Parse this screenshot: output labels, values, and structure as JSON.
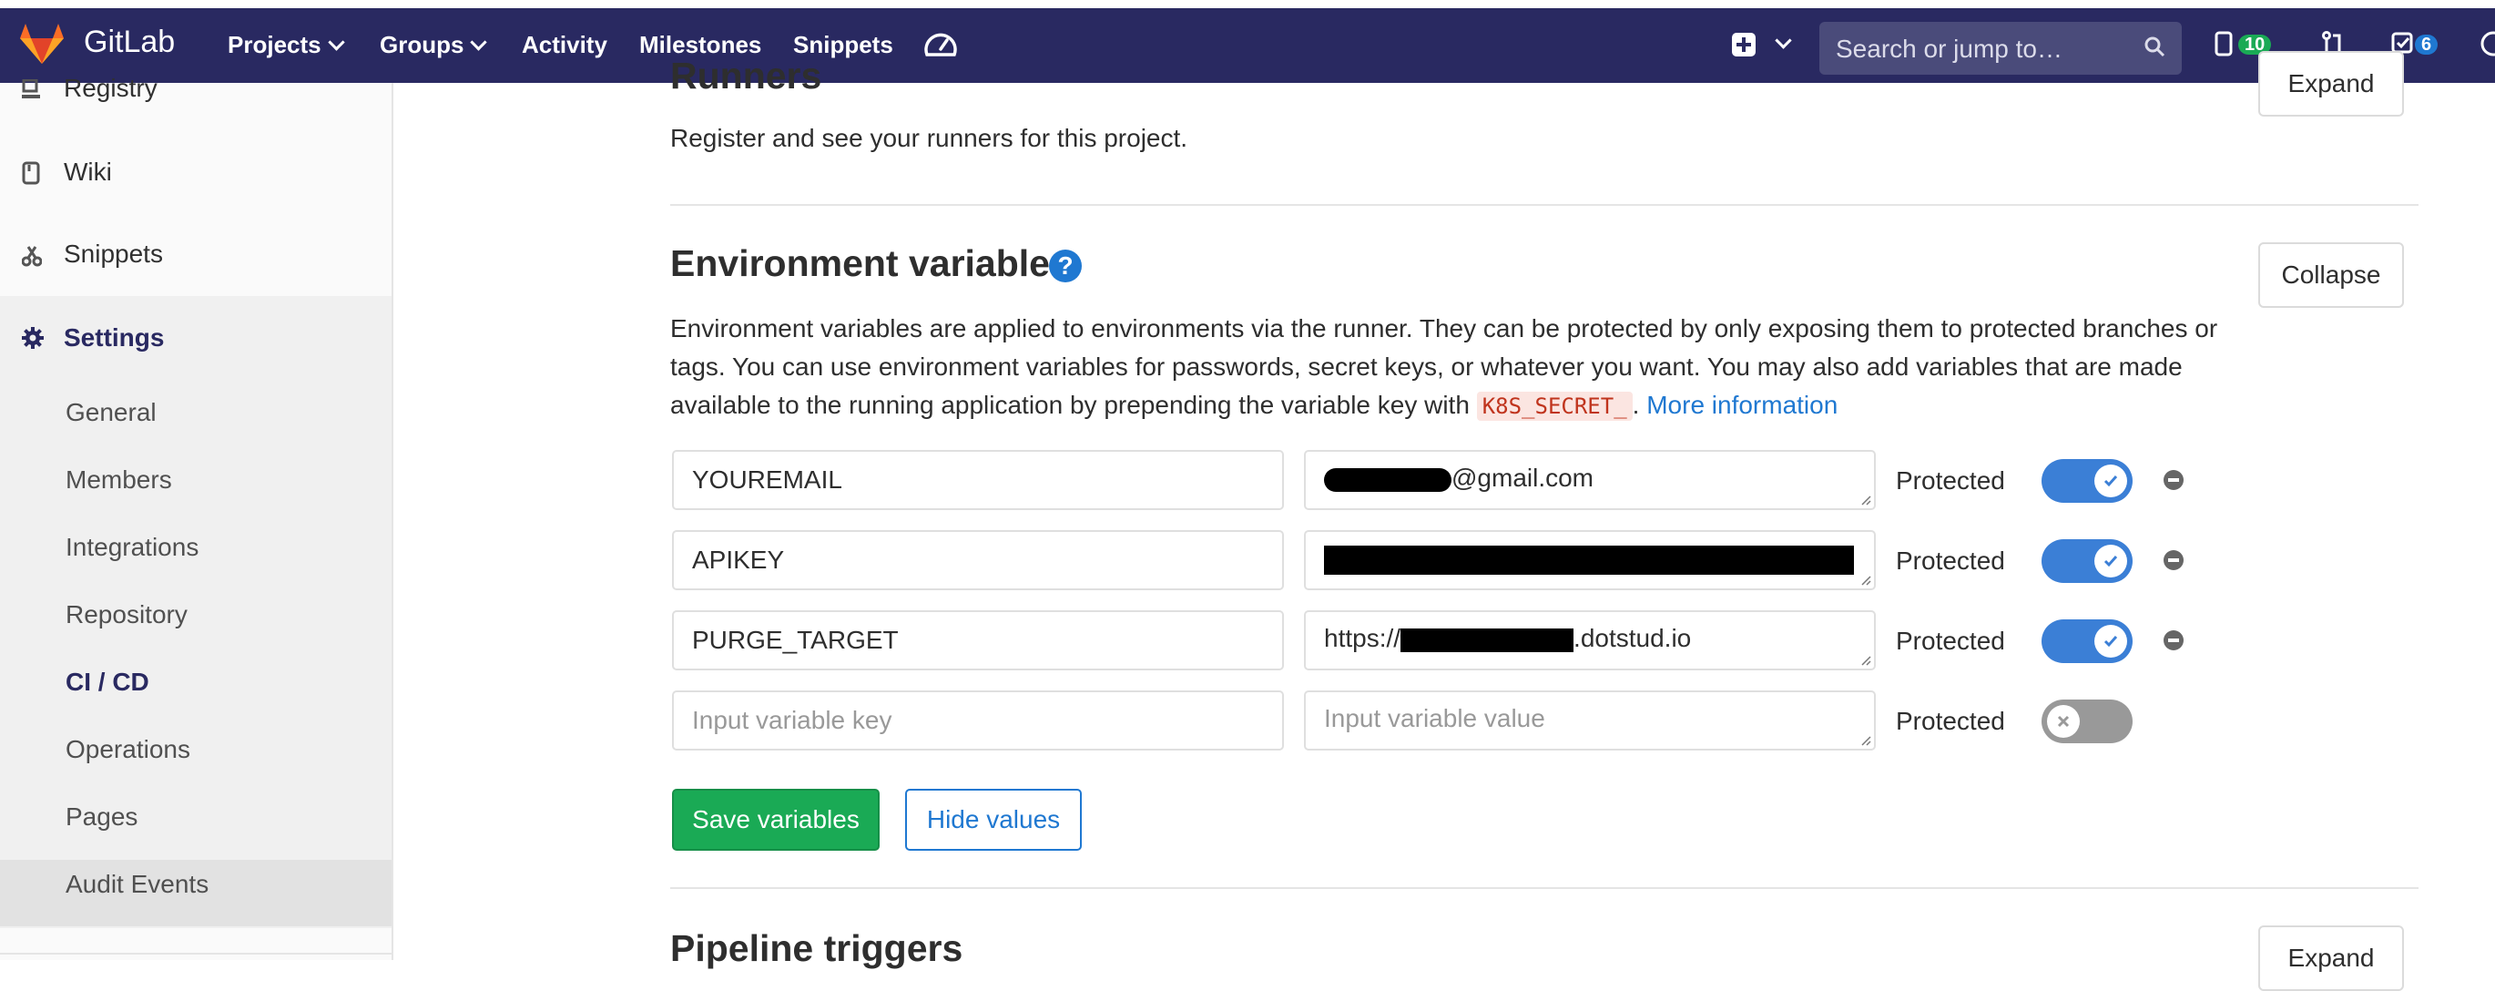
{
  "nav": {
    "brand": "GitLab",
    "items": [
      "Projects",
      "Groups",
      "Activity",
      "Milestones",
      "Snippets"
    ],
    "search_placeholder": "Search or jump to…",
    "issues_count": "10",
    "todos_count": "6",
    "colors": {
      "bar": "#292961",
      "issues_badge": "#1aaa55",
      "todos_badge": "#1f78d1"
    }
  },
  "sidebar": {
    "items": [
      {
        "label": "Registry",
        "icon": "registry-icon"
      },
      {
        "label": "Wiki",
        "icon": "book-icon"
      },
      {
        "label": "Snippets",
        "icon": "scissors-icon"
      }
    ],
    "settings": {
      "label": "Settings",
      "icon": "gear-icon"
    },
    "sub_items": [
      "General",
      "Members",
      "Integrations",
      "Repository",
      "CI / CD",
      "Operations",
      "Pages",
      "Audit Events"
    ],
    "active_sub": "CI / CD"
  },
  "runners": {
    "title": "Runners",
    "description": "Register and see your runners for this project.",
    "button": "Expand"
  },
  "env": {
    "title": "Environment variables",
    "help": "?",
    "button": "Collapse",
    "desc_1": "Environment variables are applied to environments via the runner. They can be protected by only exposing them to protected branches or tags. You can use environment variables for passwords, secret keys, or whatever you want. You may also add variables that are made available to the running application by prepending the variable key with ",
    "code": "K8S_SECRET_",
    "desc_2": ". ",
    "more_link": "More information",
    "protected_label": "Protected",
    "rows": [
      {
        "key": "YOUREMAIL",
        "value_suffix": "@gmail.com",
        "protected": true
      },
      {
        "key": "APIKEY",
        "value_suffix": "",
        "protected": true
      },
      {
        "key": "PURGE_TARGET",
        "value_prefix": "https://",
        "value_suffix": ".dotstud.io",
        "protected": true
      }
    ],
    "new_row": {
      "key_placeholder": "Input variable key",
      "value_placeholder": "Input variable value",
      "protected": false
    },
    "save_button": "Save variables",
    "hide_button": "Hide values"
  },
  "triggers": {
    "title": "Pipeline triggers",
    "button": "Expand"
  }
}
